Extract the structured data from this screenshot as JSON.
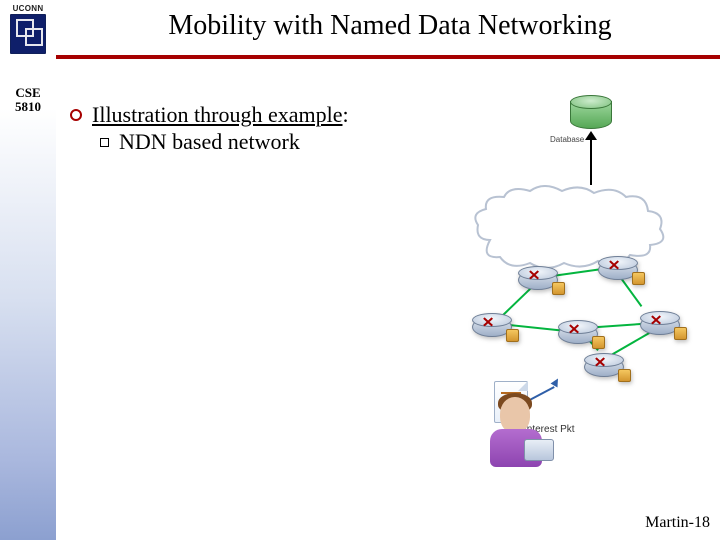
{
  "header": {
    "logo_text": "UCONN",
    "title": "Mobility with Named Data Networking"
  },
  "sidebar": {
    "course_code": "CSE 5810"
  },
  "content": {
    "main_bullet": "Illustration through example:",
    "main_bullet_prefix": "Illustration through example",
    "sub_bullet": "NDN based network"
  },
  "diagram": {
    "database_label": "Database",
    "interest_label": "Interest Pkt"
  },
  "footer": {
    "slide_ref": "Martin-18"
  }
}
